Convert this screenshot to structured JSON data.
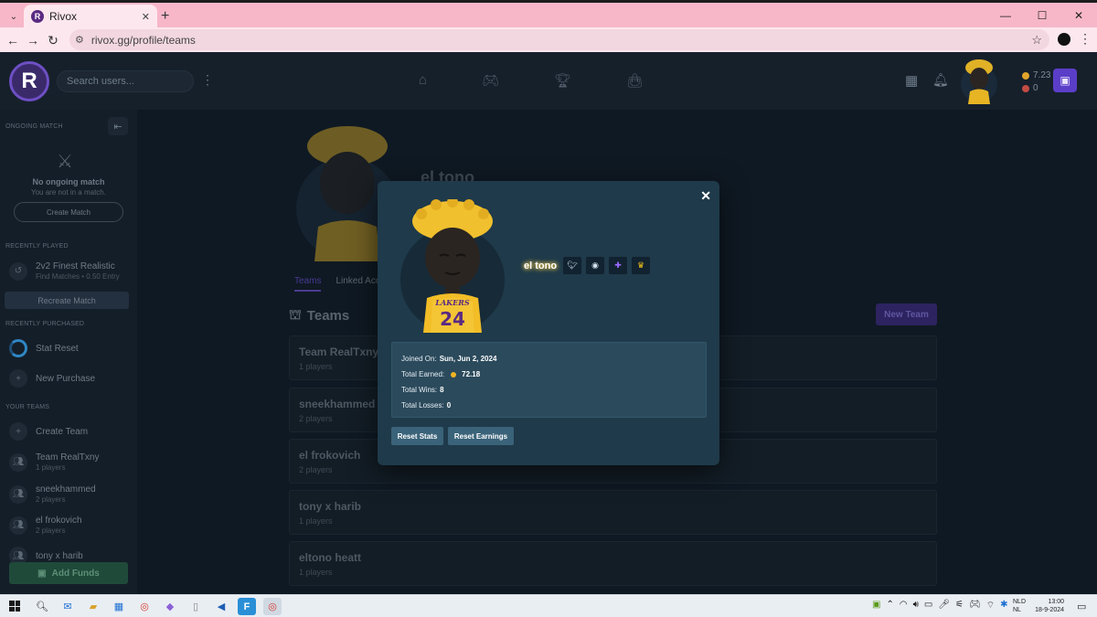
{
  "browser": {
    "tab_title": "Rivox",
    "favicon_letter": "R",
    "url": "rivox.gg/profile/teams"
  },
  "header": {
    "logo_letter": "R",
    "search_placeholder": "Search users...",
    "balance_coins": "7.23",
    "balance_points": "0"
  },
  "sidebar": {
    "ongoing_match_label": "ONGOING MATCH",
    "no_match_title": "No ongoing match",
    "no_match_sub": "You are not in a match.",
    "create_match": "Create Match",
    "recently_played_label": "RECENTLY PLAYED",
    "recent_game_title": "2v2 Finest Realistic",
    "recent_game_sub": "Find Matches • 0.50 Entry",
    "recreate_match": "Recreate Match",
    "recently_purchased_label": "RECENTLY PURCHASED",
    "purchase_item": "Stat Reset",
    "new_purchase": "New Purchase",
    "your_teams_label": "YOUR TEAMS",
    "create_team": "Create Team",
    "teams": [
      {
        "name": "Team RealTxny",
        "players": "1 players"
      },
      {
        "name": "sneekhammed",
        "players": "2 players"
      },
      {
        "name": "el frokovich",
        "players": "2 players"
      },
      {
        "name": "tony x harib",
        "players": ""
      }
    ],
    "add_funds": "Add Funds"
  },
  "profile": {
    "username": "el tono",
    "tabs": [
      "Teams",
      "Linked Acc"
    ],
    "teams_heading": "Teams",
    "new_team": "New Team",
    "team_cards": [
      {
        "name": "Team RealTxny",
        "players": "1 players"
      },
      {
        "name": "sneekhammed",
        "players": "2 players"
      },
      {
        "name": "el frokovich",
        "players": "2 players"
      },
      {
        "name": "tony x harib",
        "players": "1 players"
      },
      {
        "name": "eltono heatt",
        "players": "1 players"
      }
    ]
  },
  "modal": {
    "username": "el tono",
    "joined_label": "Joined On:",
    "joined_value": "Sun, Jun 2, 2024",
    "earned_label": "Total Earned:",
    "earned_value": "72.18",
    "wins_label": "Total Wins:",
    "wins_value": "8",
    "losses_label": "Total Losses:",
    "losses_value": "0",
    "reset_stats": "Reset Stats",
    "reset_earnings": "Reset Earnings",
    "social_icons": [
      "twitter-icon",
      "discord-icon",
      "twitch-icon",
      "crown-icon"
    ]
  },
  "taskbar": {
    "lang_top": "NLD",
    "lang_bottom": "NL",
    "time": "13:00",
    "date": "18-9-2024"
  },
  "colors": {
    "accent": "#5b3ec8",
    "modal_bg": "#1f3a4a",
    "gold": "#f0b323"
  }
}
